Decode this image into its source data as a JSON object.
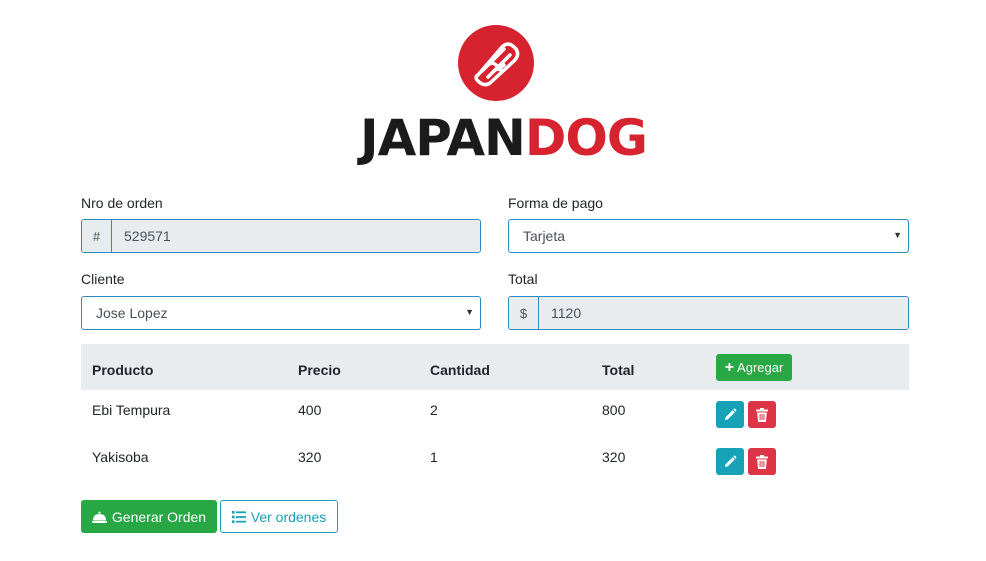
{
  "logo": {
    "text_part1": "JAPAN",
    "text_part2": "DOG",
    "icon": "hotdog-icon",
    "accent": "#d6232f"
  },
  "form": {
    "order_number": {
      "label": "Nro de orden",
      "prefix": "#",
      "value": "529571"
    },
    "payment_method": {
      "label": "Forma de pago",
      "selected": "Tarjeta"
    },
    "client": {
      "label": "Cliente",
      "selected": "Jose Lopez"
    },
    "total": {
      "label": "Total",
      "prefix": "$",
      "value": "1120"
    }
  },
  "table": {
    "headers": {
      "product": "Producto",
      "price": "Precio",
      "quantity": "Cantidad",
      "total": "Total"
    },
    "add_label": "Agregar",
    "rows": [
      {
        "product": "Ebi Tempura",
        "price": "400",
        "quantity": "2",
        "total": "800"
      },
      {
        "product": "Yakisoba",
        "price": "320",
        "quantity": "1",
        "total": "320"
      }
    ]
  },
  "actions": {
    "generate_label": "Generar Orden",
    "view_label": "Ver ordenes"
  },
  "colors": {
    "success": "#28a745",
    "info": "#17a2b8",
    "danger": "#dc3545",
    "border": "#2a8cc4"
  }
}
